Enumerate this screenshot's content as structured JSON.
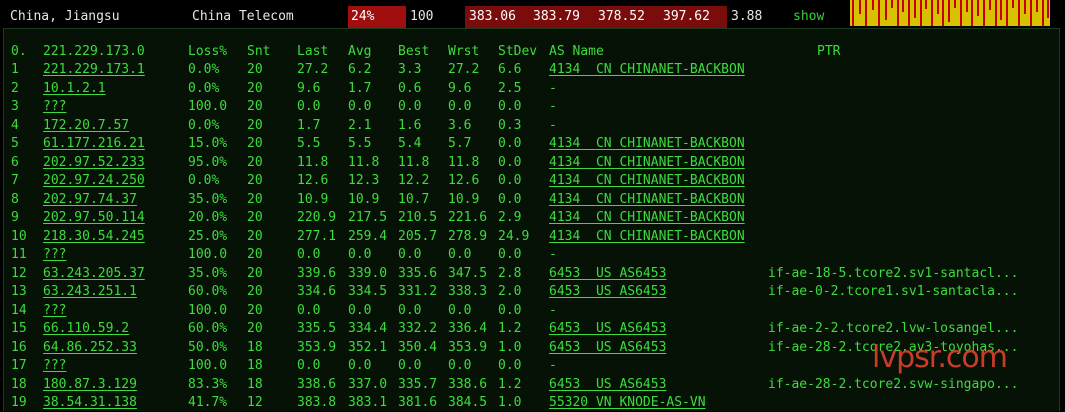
{
  "topbar": {
    "location": "China, Jiangsu",
    "isp": "China Telecom",
    "loss": "24%",
    "sent": "100",
    "last": "383.06",
    "avg": "383.79",
    "best": "378.52",
    "worst": "397.62",
    "stdev": "3.88",
    "show_label": "show"
  },
  "headers": {
    "num": "0.",
    "host": "221.229.173.0",
    "loss": "Loss%",
    "snt": "Snt",
    "last": "Last",
    "avg": "Avg",
    "best": "Best",
    "wrst": "Wrst",
    "stdev": "StDev",
    "as": "AS Name",
    "ptr": "PTR"
  },
  "hops": [
    {
      "n": "1",
      "host": "221.229.173.1",
      "loss": "0.0%",
      "snt": "20",
      "last": "27.2",
      "avg": "6.2",
      "best": "3.3",
      "wrst": "27.2",
      "stdev": "6.6",
      "as": "4134  CN CHINANET-BACKBON",
      "ptr": ""
    },
    {
      "n": "2",
      "host": "10.1.2.1",
      "loss": "0.0%",
      "snt": "20",
      "last": "9.6",
      "avg": "1.7",
      "best": "0.6",
      "wrst": "9.6",
      "stdev": "2.5",
      "as": "-",
      "ptr": ""
    },
    {
      "n": "3",
      "host": "???",
      "loss": "100.0",
      "snt": "20",
      "last": "0.0",
      "avg": "0.0",
      "best": "0.0",
      "wrst": "0.0",
      "stdev": "0.0",
      "as": "-",
      "ptr": ""
    },
    {
      "n": "4",
      "host": "172.20.7.57",
      "loss": "0.0%",
      "snt": "20",
      "last": "1.7",
      "avg": "2.1",
      "best": "1.6",
      "wrst": "3.6",
      "stdev": "0.3",
      "as": "-",
      "ptr": ""
    },
    {
      "n": "5",
      "host": "61.177.216.21",
      "loss": "15.0%",
      "snt": "20",
      "last": "5.5",
      "avg": "5.5",
      "best": "5.4",
      "wrst": "5.7",
      "stdev": "0.0",
      "as": "4134  CN CHINANET-BACKBON",
      "ptr": ""
    },
    {
      "n": "6",
      "host": "202.97.52.233",
      "loss": "95.0%",
      "snt": "20",
      "last": "11.8",
      "avg": "11.8",
      "best": "11.8",
      "wrst": "11.8",
      "stdev": "0.0",
      "as": "4134  CN CHINANET-BACKBON",
      "ptr": ""
    },
    {
      "n": "7",
      "host": "202.97.24.250",
      "loss": "0.0%",
      "snt": "20",
      "last": "12.6",
      "avg": "12.3",
      "best": "12.2",
      "wrst": "12.6",
      "stdev": "0.0",
      "as": "4134  CN CHINANET-BACKBON",
      "ptr": ""
    },
    {
      "n": "8",
      "host": "202.97.74.37",
      "loss": "35.0%",
      "snt": "20",
      "last": "10.9",
      "avg": "10.9",
      "best": "10.7",
      "wrst": "10.9",
      "stdev": "0.0",
      "as": "4134  CN CHINANET-BACKBON",
      "ptr": ""
    },
    {
      "n": "9",
      "host": "202.97.50.114",
      "loss": "20.0%",
      "snt": "20",
      "last": "220.9",
      "avg": "217.5",
      "best": "210.5",
      "wrst": "221.6",
      "stdev": "2.9",
      "as": "4134  CN CHINANET-BACKBON",
      "ptr": ""
    },
    {
      "n": "10",
      "host": "218.30.54.245",
      "loss": "25.0%",
      "snt": "20",
      "last": "277.1",
      "avg": "259.4",
      "best": "205.7",
      "wrst": "278.9",
      "stdev": "24.9",
      "as": "4134  CN CHINANET-BACKBON",
      "ptr": ""
    },
    {
      "n": "11",
      "host": "???",
      "loss": "100.0",
      "snt": "20",
      "last": "0.0",
      "avg": "0.0",
      "best": "0.0",
      "wrst": "0.0",
      "stdev": "0.0",
      "as": "-",
      "ptr": ""
    },
    {
      "n": "12",
      "host": "63.243.205.37",
      "loss": "35.0%",
      "snt": "20",
      "last": "339.6",
      "avg": "339.0",
      "best": "335.6",
      "wrst": "347.5",
      "stdev": "2.8",
      "as": "6453  US AS6453",
      "ptr": "if-ae-18-5.tcore2.sv1-santacl..."
    },
    {
      "n": "13",
      "host": "63.243.251.1",
      "loss": "60.0%",
      "snt": "20",
      "last": "334.6",
      "avg": "334.5",
      "best": "331.2",
      "wrst": "338.3",
      "stdev": "2.0",
      "as": "6453  US AS6453",
      "ptr": "if-ae-0-2.tcore1.sv1-santacla..."
    },
    {
      "n": "14",
      "host": "???",
      "loss": "100.0",
      "snt": "20",
      "last": "0.0",
      "avg": "0.0",
      "best": "0.0",
      "wrst": "0.0",
      "stdev": "0.0",
      "as": "-",
      "ptr": ""
    },
    {
      "n": "15",
      "host": "66.110.59.2",
      "loss": "60.0%",
      "snt": "20",
      "last": "335.5",
      "avg": "334.4",
      "best": "332.2",
      "wrst": "336.4",
      "stdev": "1.2",
      "as": "6453  US AS6453",
      "ptr": "if-ae-2-2.tcore2.lvw-losangel..."
    },
    {
      "n": "16",
      "host": "64.86.252.33",
      "loss": "50.0%",
      "snt": "18",
      "last": "353.9",
      "avg": "352.1",
      "best": "350.4",
      "wrst": "353.9",
      "stdev": "1.0",
      "as": "6453  US AS6453",
      "ptr": "if-ae-28-2.tcore2.av3-toyohas..."
    },
    {
      "n": "17",
      "host": "???",
      "loss": "100.0",
      "snt": "18",
      "last": "0.0",
      "avg": "0.0",
      "best": "0.0",
      "wrst": "0.0",
      "stdev": "0.0",
      "as": "-",
      "ptr": ""
    },
    {
      "n": "18",
      "host": "180.87.3.129",
      "loss": "83.3%",
      "snt": "18",
      "last": "338.6",
      "avg": "337.0",
      "best": "335.7",
      "wrst": "338.6",
      "stdev": "1.2",
      "as": "6453  US AS6453",
      "ptr": "if-ae-28-2.tcore2.svw-singapo..."
    },
    {
      "n": "19",
      "host": "38.54.31.138",
      "loss": "41.7%",
      "snt": "12",
      "last": "383.8",
      "avg": "383.1",
      "best": "381.6",
      "wrst": "384.5",
      "stdev": "1.0",
      "as": "55320 VN KNODE-AS-VN",
      "ptr": ""
    }
  ],
  "watermark": "lvpsr.com",
  "colors": {
    "text_green": "#3ddc3d",
    "panel_bg": "#061206",
    "loss_red": "#a00f0f",
    "cell_red": "#7a0c0c",
    "spark_yellow": "#d6c200",
    "spark_red": "#c80000"
  }
}
